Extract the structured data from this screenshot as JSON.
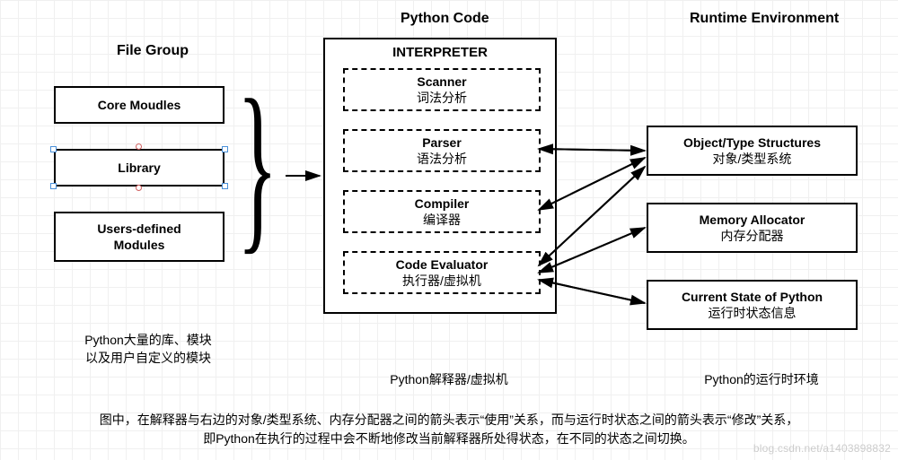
{
  "columns": {
    "file_group": "File Group",
    "python_code": "Python Code",
    "runtime_env": "Runtime Environment"
  },
  "file_group": {
    "core_modules": "Core Moudles",
    "library": "Library",
    "user_modules_l1": "Users-defined",
    "user_modules_l2": "Modules",
    "caption_l1": "Python大量的库、模块",
    "caption_l2": "以及用户自定义的模块"
  },
  "interpreter": {
    "title": "INTERPRETER",
    "scanner_en": "Scanner",
    "scanner_zh": "词法分析",
    "parser_en": "Parser",
    "parser_zh": "语法分析",
    "compiler_en": "Compiler",
    "compiler_zh": "编译器",
    "evaluator_en": "Code Evaluator",
    "evaluator_zh": "执行器/虚拟机",
    "caption": "Python解释器/虚拟机"
  },
  "runtime": {
    "obj_en": "Object/Type Structures",
    "obj_zh": "对象/类型系统",
    "mem_en": "Memory Allocator",
    "mem_zh": "内存分配器",
    "state_en": "Current State of Python",
    "state_zh": "运行时状态信息",
    "caption": "Python的运行时环境"
  },
  "footer": {
    "line1": "图中，在解释器与右边的对象/类型系统、内存分配器之间的箭头表示“使用”关系，而与运行时状态之间的箭头表示“修改”关系，",
    "line2": "即Python在执行的过程中会不断地修改当前解释器所处得状态，在不同的状态之间切换。"
  },
  "watermark": "blog.csdn.net/a1403898832"
}
